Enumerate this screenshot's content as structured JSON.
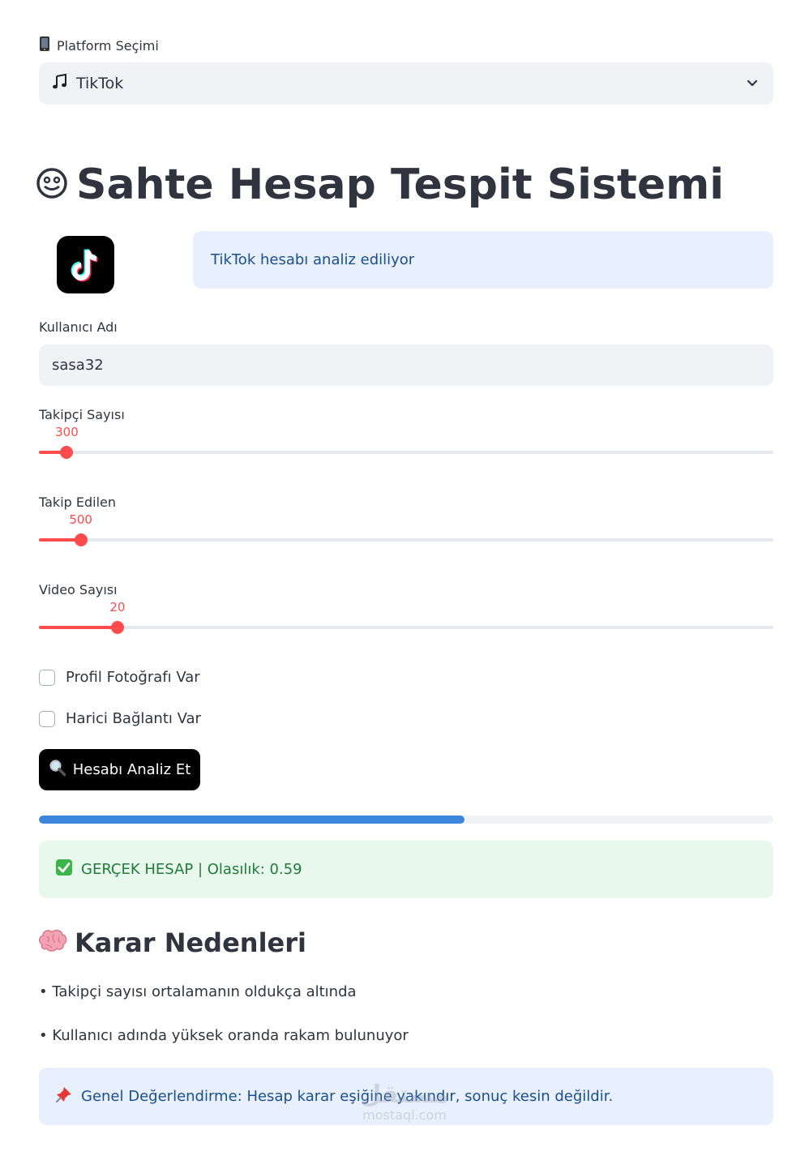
{
  "platform": {
    "label": "Platform Seçimi",
    "label_icon": "mobile-phone-icon",
    "selected": "TikTok",
    "selected_icon": "music-note-icon"
  },
  "title": {
    "text": "Sahte Hesap Tespit Sistemi",
    "icon": "face-icon"
  },
  "info": {
    "text": "TikTok hesabı analiz ediliyor"
  },
  "username": {
    "label": "Kullanıcı Adı",
    "value": "sasa32"
  },
  "sliders": [
    {
      "label": "Takipçi Sayısı",
      "value": "300",
      "fraction": 0.038
    },
    {
      "label": "Takip Edilen",
      "value": "500",
      "fraction": 0.057
    },
    {
      "label": "Video Sayısı",
      "value": "20",
      "fraction": 0.107
    }
  ],
  "checkboxes": [
    {
      "label": "Profil Fotoğrafı Var",
      "checked": false
    },
    {
      "label": "Harici Bağlantı Var",
      "checked": false
    }
  ],
  "analyze_button": {
    "label": "Hesabı Analiz Et",
    "icon": "magnifier-icon"
  },
  "progress": {
    "fraction": 0.58
  },
  "result": {
    "text": "GERÇEK HESAP | Olasılık: 0.59",
    "icon": "check-mark-icon"
  },
  "reasons": {
    "title": "Karar Nedenleri",
    "icon": "brain-icon",
    "items": [
      "• Takipçi sayısı ortalamanın oldukça altında",
      "• Kullanıcı adında yüksek oranda rakam bulunuyor"
    ]
  },
  "summary": {
    "text": "Genel Değerlendirme: Hesap karar eşiğine yakındır, sonuç kesin değildir.",
    "icon": "pushpin-icon"
  },
  "watermark": {
    "arabic": "مستقل",
    "latin": "mostaql.com"
  },
  "colors": {
    "accent": "#ff4b4b",
    "progress": "#3c86dd",
    "info_bg": "#e8f0fe",
    "success_bg": "#e9f8ec"
  }
}
